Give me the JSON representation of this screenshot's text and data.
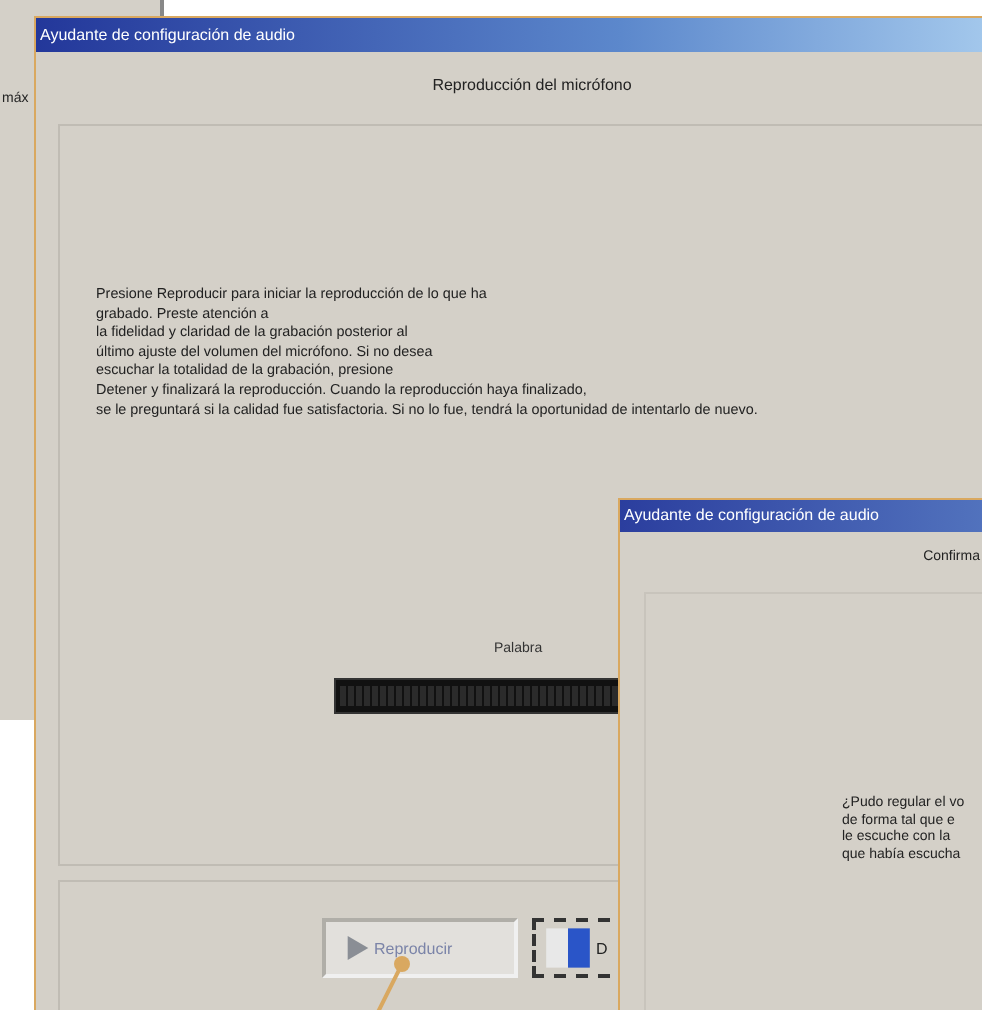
{
  "background_window": {
    "label": "máx"
  },
  "main_window": {
    "title": "Ayudante de configuración de audio",
    "heading": "Reproducción del micrófono",
    "instructions": [
      "Presione Reproducir para iniciar la reproducción de lo que ha",
      "grabado. Preste atención a",
      "la fidelidad y claridad de la grabación posterior al",
      "último ajuste del volumen del micrófono. Si no desea",
      "escuchar la totalidad de la grabación, presione",
      "Detener y finalizará la reproducción.   Cuando la reproducción haya finalizado,",
      "se le preguntará si la calidad fue satisfactoria.  Si no lo fue, tendrá la oportunidad de intentarlo de nuevo."
    ],
    "meter": {
      "label": "Palabra"
    },
    "buttons": [
      {
        "label": "Reproducir",
        "kind": "play",
        "disabled": true
      },
      {
        "label": "D",
        "kind": "stop",
        "disabled": false
      }
    ]
  },
  "second_window": {
    "title": "Ayudante de configuración de audio",
    "heading": "Confirma",
    "question_lines": [
      "¿Pudo regular el vo",
      "de forma tal que e",
      "le escuche con la",
      "que había escucha"
    ]
  }
}
